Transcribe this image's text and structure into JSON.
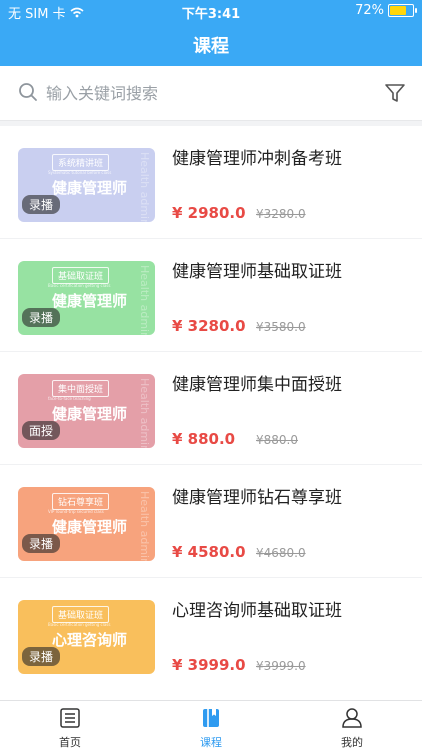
{
  "status": {
    "carrier": "无 SIM 卡",
    "time": "下午3:41",
    "battery": "72%",
    "battery_level": 0.72
  },
  "navbar": {
    "title": "课程"
  },
  "search": {
    "placeholder": "输入关键词搜索"
  },
  "courses": [
    {
      "title": "健康管理师冲刺备考班",
      "price": "¥ 2980.0",
      "original": "¥3280.0",
      "thumb": {
        "tag": "系统精讲班",
        "sub": "Systematic tutorial before class",
        "big": "健康管理师",
        "side": "Health administrator",
        "badge": "录播",
        "bg": "#c9cff0"
      }
    },
    {
      "title": "健康管理师基础取证班",
      "price": "¥ 3280.0",
      "original": "¥3580.0",
      "thumb": {
        "tag": "基础取证班",
        "sub": "Basic certification getting class",
        "big": "健康管理师",
        "side": "Health administrator",
        "badge": "录播",
        "bg": "#97e2a2"
      }
    },
    {
      "title": "健康管理师集中面授班",
      "price": "¥ 880.0",
      "original": "¥880.0",
      "thumb": {
        "tag": "集中面授班",
        "sub": "face-to-face teaching",
        "big": "健康管理师",
        "side": "Health administrator",
        "badge": "面授",
        "bg": "#e49fa8"
      }
    },
    {
      "title": "健康管理师钻石尊享班",
      "price": "¥ 4580.0",
      "original": "¥4680.0",
      "thumb": {
        "tag": "钻石尊享班",
        "sub": "VIP round-trip secured class",
        "big": "健康管理师",
        "side": "Health administrator",
        "badge": "录播",
        "bg": "#f7a37d"
      }
    },
    {
      "title": "心理咨询师基础取证班",
      "price": "¥ 3999.0",
      "original": "¥3999.0",
      "thumb": {
        "tag": "基础取证班",
        "sub": "Basic certification getting class",
        "big": "心理咨询师",
        "side": "",
        "badge": "录播",
        "bg": "#f9bf5c"
      }
    }
  ],
  "tabbar": [
    {
      "label": "首页",
      "icon": "home-list-icon",
      "active": false
    },
    {
      "label": "课程",
      "icon": "book-icon",
      "active": true
    },
    {
      "label": "我的",
      "icon": "user-icon",
      "active": false
    }
  ],
  "colors": {
    "primary": "#3aa9f5",
    "price": "#e84a45",
    "active_tab": "#2f9bf0"
  }
}
